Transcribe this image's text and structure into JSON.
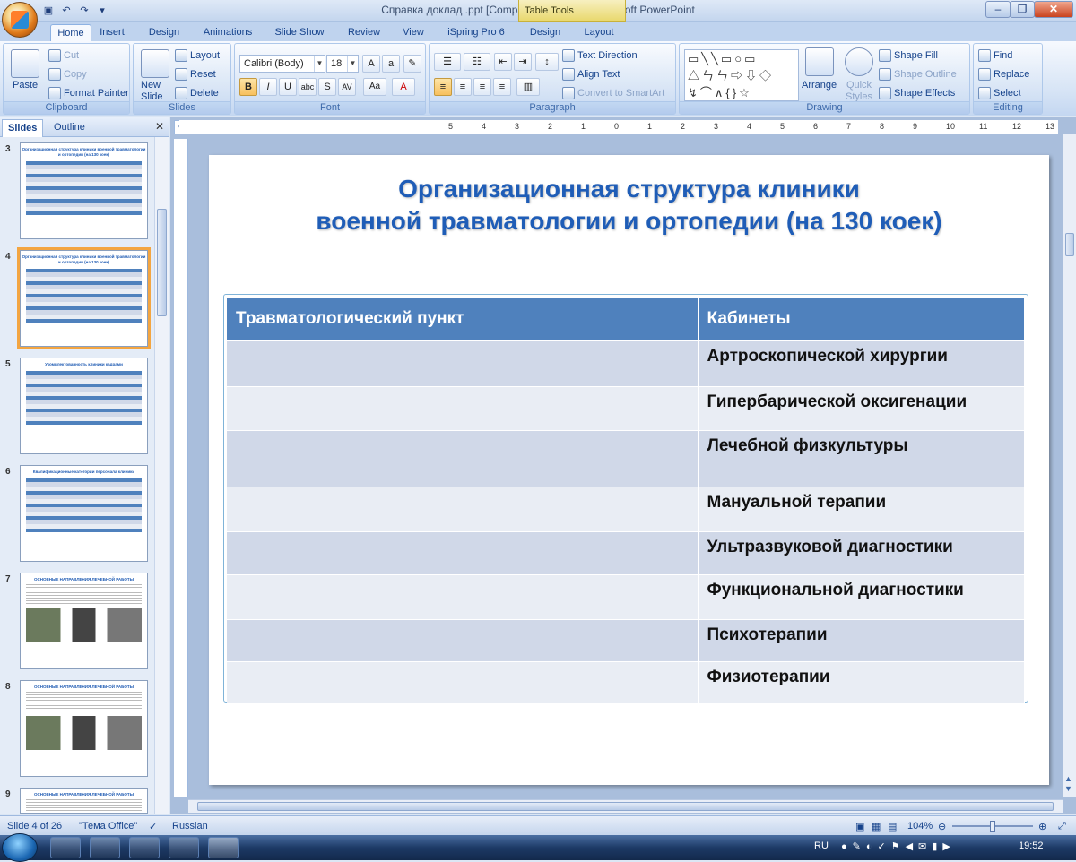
{
  "window": {
    "title": "Справка доклад .ppt [Compatibility Mode] - Microsoft PowerPoint",
    "context_tab": "Table Tools"
  },
  "tabs": [
    "Home",
    "Insert",
    "Design",
    "Animations",
    "Slide Show",
    "Review",
    "View",
    "iSpring Pro 6",
    "Design",
    "Layout"
  ],
  "ribbon": {
    "clipboard": {
      "label": "Clipboard",
      "paste": "Paste",
      "cut": "Cut",
      "copy": "Copy",
      "format_painter": "Format Painter"
    },
    "slides": {
      "label": "Slides",
      "new_slide": "New Slide",
      "layout": "Layout",
      "reset": "Reset",
      "delete": "Delete"
    },
    "font": {
      "label": "Font",
      "font_name": "Calibri (Body)",
      "font_size": "18"
    },
    "paragraph": {
      "label": "Paragraph",
      "text_direction": "Text Direction",
      "align_text": "Align Text",
      "convert_smartart": "Convert to SmartArt"
    },
    "drawing": {
      "label": "Drawing",
      "arrange": "Arrange",
      "quick_styles": "Quick Styles",
      "shape_fill": "Shape Fill",
      "shape_outline": "Shape Outline",
      "shape_effects": "Shape Effects"
    },
    "editing": {
      "label": "Editing",
      "find": "Find",
      "replace": "Replace",
      "select": "Select"
    }
  },
  "pane": {
    "tab_slides": "Slides",
    "tab_outline": "Outline",
    "thumbs": [
      {
        "num": "3",
        "title": "Организационная структура клиники военной травматологии и ортопедии (на 130 коек)",
        "kind": "table"
      },
      {
        "num": "4",
        "title": "Организационная структура клиники военной травматологии и ортопедии (на 130 коек)",
        "kind": "table",
        "selected": true
      },
      {
        "num": "5",
        "title": "Укомплектованность клиники кадрами",
        "kind": "table"
      },
      {
        "num": "6",
        "title": "Квалификационные категории персонала клиники",
        "kind": "table"
      },
      {
        "num": "7",
        "title": "ОСНОВНЫЕ НАПРАВЛЕНИЯ ЛЕЧЕБНОЙ РАБОТЫ",
        "kind": "pics"
      },
      {
        "num": "8",
        "title": "ОСНОВНЫЕ НАПРАВЛЕНИЯ ЛЕЧЕБНОЙ РАБОТЫ",
        "kind": "pics"
      },
      {
        "num": "9",
        "title": "ОСНОВНЫЕ НАПРАВЛЕНИЯ ЛЕЧЕБНОЙ РАБОТЫ",
        "kind": "text"
      }
    ]
  },
  "slide": {
    "title_line1": "Организационная структура клиники",
    "title_line2": "военной травматологии и ортопедии (на 130 коек)",
    "table": {
      "headers": [
        "Травматологический пункт",
        "Кабинеты"
      ],
      "rows": [
        [
          "",
          "Артроскопической хирургии"
        ],
        [
          "",
          "Гипербарической оксигенации"
        ],
        [
          "",
          "Лечебной физкультуры"
        ],
        [
          "",
          "Мануальной терапии"
        ],
        [
          "",
          "Ультразвуковой диагностики"
        ],
        [
          "",
          "Функциональной диагностики"
        ],
        [
          "",
          "Психотерапии"
        ],
        [
          "",
          "Физиотерапии"
        ]
      ]
    }
  },
  "status": {
    "slide": "Slide 4 of 26",
    "theme": "\"Тема Office\"",
    "language": "Russian",
    "zoom": "104%"
  },
  "tray": {
    "lang": "RU",
    "time": "19:52"
  }
}
